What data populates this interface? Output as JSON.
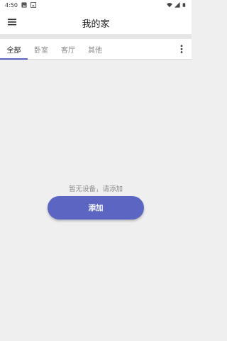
{
  "status_bar": {
    "time": "4:50",
    "left_icons": [
      "image-icon",
      "photo-icon"
    ],
    "right_icons": [
      "wifi-icon",
      "signal-icon",
      "battery-icon"
    ]
  },
  "app_bar": {
    "title": "我的家",
    "menu_icon": "menu-icon"
  },
  "tabs": [
    {
      "label": "全部",
      "active": true
    },
    {
      "label": "卧室",
      "active": false
    },
    {
      "label": "客厅",
      "active": false
    },
    {
      "label": "其他",
      "active": false
    }
  ],
  "tab_more_icon": "more-vertical-icon",
  "empty_state": {
    "message": "暂无设备，请添加",
    "button_label": "添加"
  },
  "colors": {
    "accent": "#5c66c2",
    "background": "#efefef"
  }
}
